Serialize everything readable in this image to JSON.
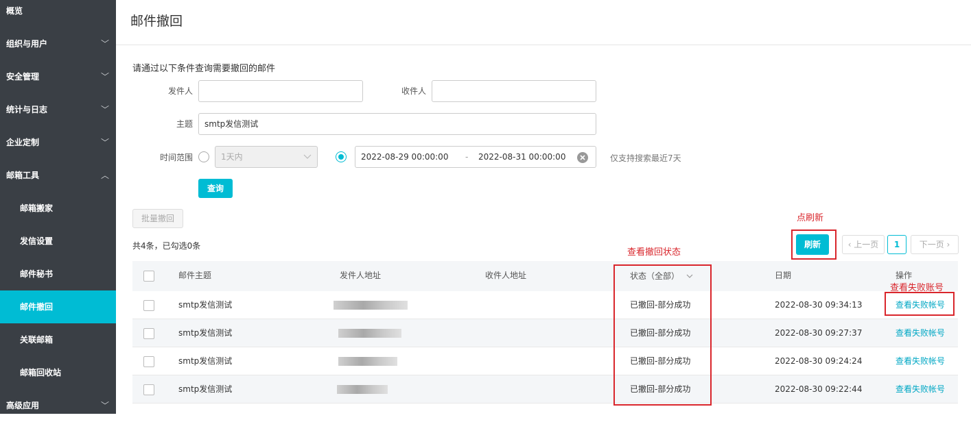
{
  "sidebar": {
    "items": [
      {
        "label": "概览",
        "chevron": ""
      },
      {
        "label": "组织与用户",
        "chevron": "﹀"
      },
      {
        "label": "安全管理",
        "chevron": "﹀"
      },
      {
        "label": "统计与日志",
        "chevron": "﹀"
      },
      {
        "label": "企业定制",
        "chevron": "﹀"
      },
      {
        "label": "邮箱工具",
        "chevron": "︿"
      },
      {
        "label": "邮箱搬家",
        "chevron": ""
      },
      {
        "label": "发信设置",
        "chevron": ""
      },
      {
        "label": "邮件秘书",
        "chevron": ""
      },
      {
        "label": "邮件撤回",
        "chevron": ""
      },
      {
        "label": "关联邮箱",
        "chevron": ""
      },
      {
        "label": "邮箱回收站",
        "chevron": ""
      },
      {
        "label": "高级应用",
        "chevron": "﹀"
      }
    ]
  },
  "page": {
    "title": "邮件撤回",
    "instructions": "请通过以下条件查询需要撤回的邮件"
  },
  "form": {
    "sender_label": "发件人",
    "sender_value": "",
    "recipient_label": "收件人",
    "recipient_value": "",
    "subject_label": "主题",
    "subject_value": "smtp发信测试",
    "time_label": "时间范围",
    "time_preset": "1天内",
    "date_start": "2022-08-29 00:00:00",
    "date_sep": "-",
    "date_end": "2022-08-31 00:00:00",
    "date_note": "仅支持搜索最近7天",
    "query_button": "查询"
  },
  "toolbar": {
    "batch_recall": "批量撤回",
    "count_text": "共4条，已勾选0条",
    "refresh": "刷新",
    "prev": "‹ 上一页",
    "page": "1",
    "next": "下一页 ›"
  },
  "table": {
    "headers": {
      "subject": "邮件主题",
      "sender": "发件人地址",
      "recipient": "收件人地址",
      "status": "状态（全部）",
      "date": "日期",
      "action": "操作"
    },
    "rows": [
      {
        "subject": "smtp发信测试",
        "status": "已撤回-部分成功",
        "date": "2022-08-30 09:34:13",
        "action": "查看失败帐号"
      },
      {
        "subject": "smtp发信测试",
        "status": "已撤回-部分成功",
        "date": "2022-08-30 09:27:37",
        "action": "查看失败帐号"
      },
      {
        "subject": "smtp发信测试",
        "status": "已撤回-部分成功",
        "date": "2022-08-30 09:24:24",
        "action": "查看失败帐号"
      },
      {
        "subject": "smtp发信测试",
        "status": "已撤回-部分成功",
        "date": "2022-08-30 09:22:44",
        "action": "查看失败帐号"
      }
    ]
  },
  "annotations": {
    "refresh_note": "点刷新",
    "status_note": "查看撤回状态",
    "failed_note": "查看失败账号"
  },
  "colors": {
    "accent": "#00bcd4",
    "annotation": "#d9252b",
    "sidebar": "#3a3f45"
  }
}
